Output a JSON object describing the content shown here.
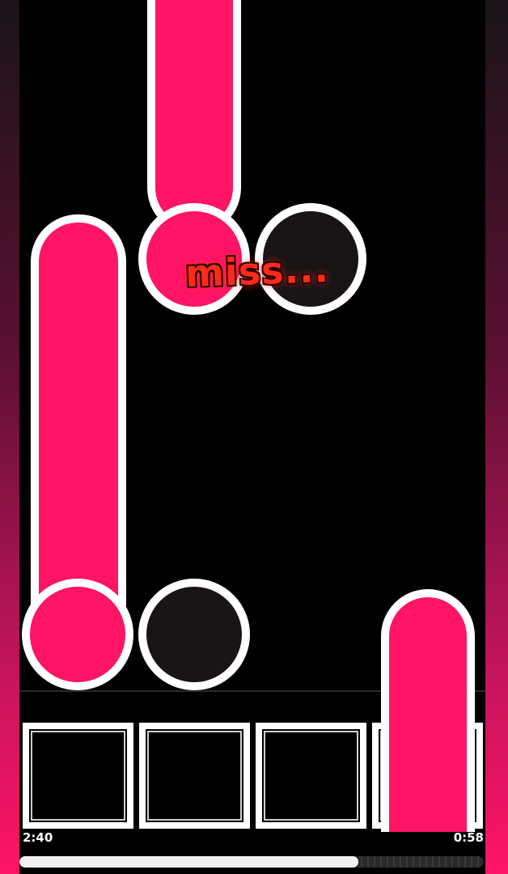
{
  "game": {
    "judgement": "miss...",
    "time_elapsed": "2:40",
    "time_remaining": "0:58",
    "song_progress": 0.73,
    "lanes": 4
  },
  "colors": {
    "note_pink": "#ff1466",
    "note_dark": "#191415",
    "outline": "#ffffff",
    "miss": "#ff2a1a",
    "background": "#000000"
  },
  "icons": {
    "tap_note": "circle-note",
    "hold_note": "hold-bar-note",
    "receptor": "square-receptor"
  }
}
